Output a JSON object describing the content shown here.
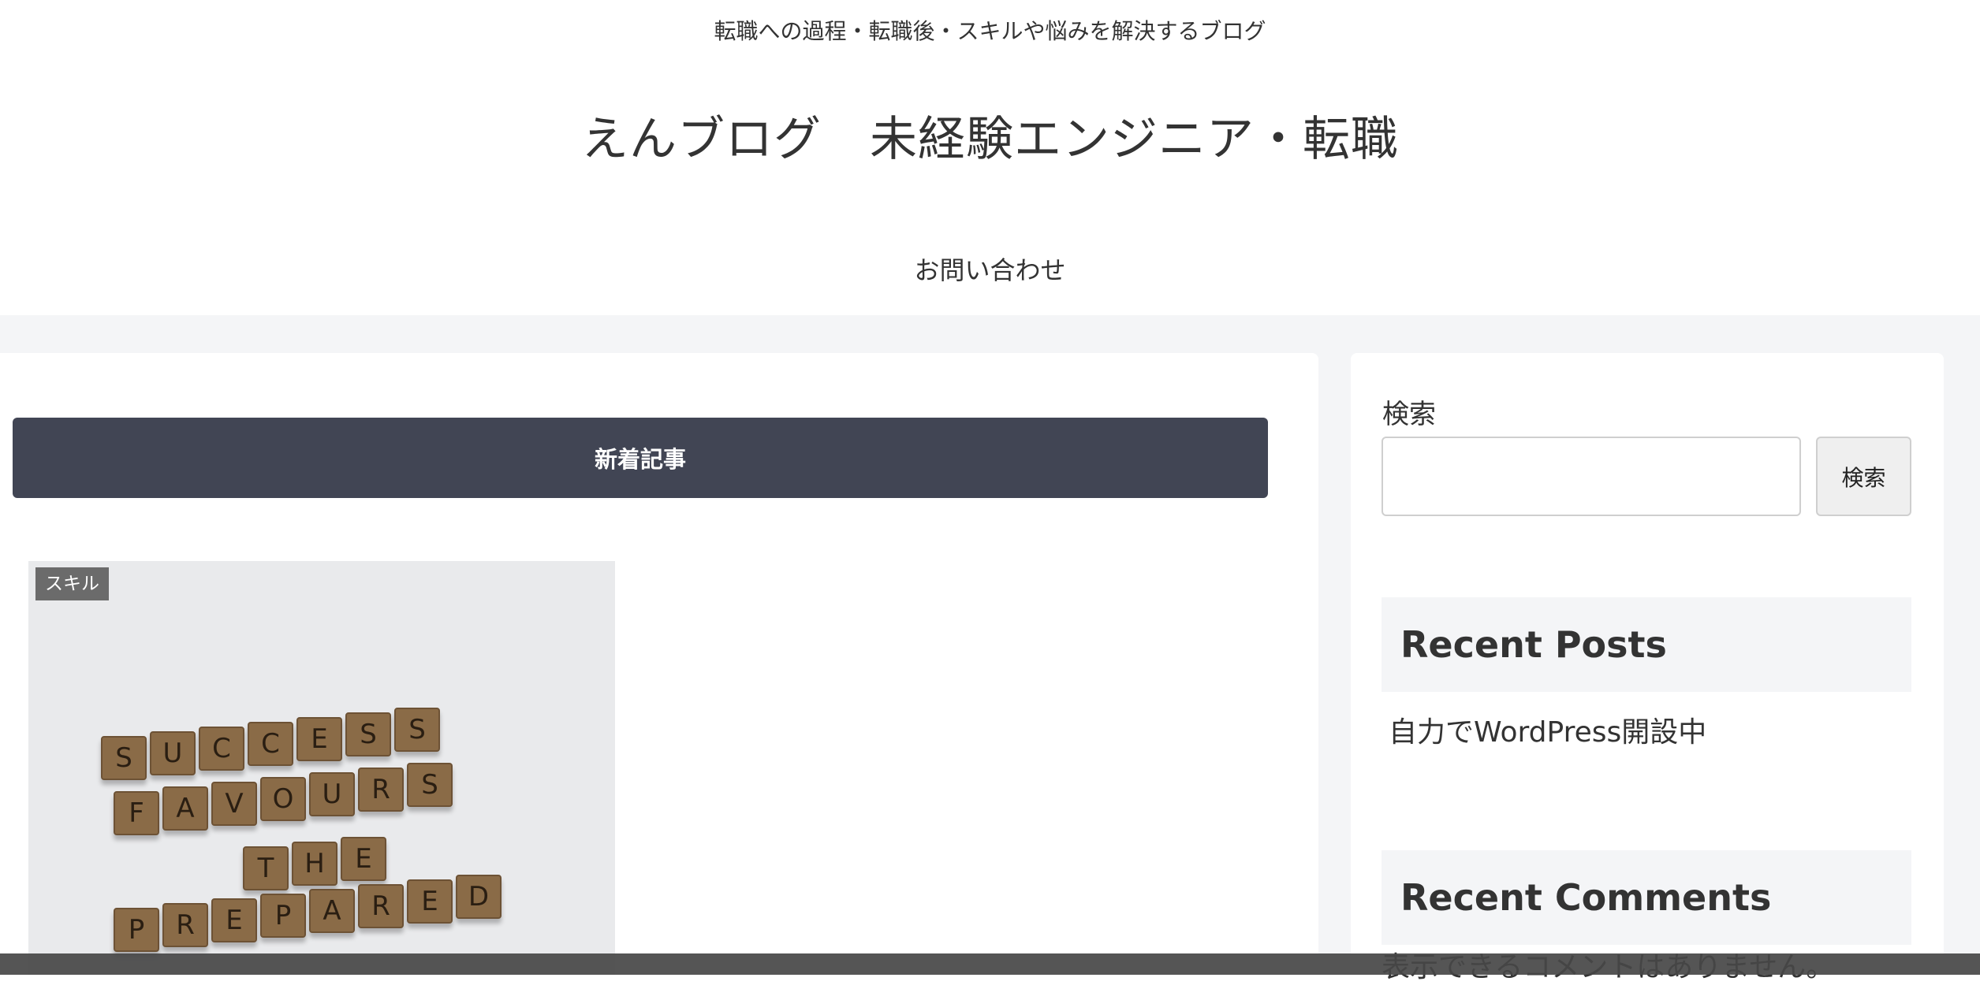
{
  "header": {
    "tagline": "転職への過程・転職後・スキルや悩みを解決するブログ",
    "site_title": "えんブログ　未経験エンジニア・転職",
    "nav": [
      {
        "label": "お問い合わせ"
      }
    ]
  },
  "main": {
    "section_heading": "新着記事",
    "posts": [
      {
        "category": "スキル",
        "thumbnail_tiles": [
          "SUCCESS",
          "FAVOURS",
          "THE",
          "PREPARED"
        ]
      }
    ]
  },
  "sidebar": {
    "search": {
      "label": "検索",
      "button_label": "検索",
      "value": "",
      "placeholder": ""
    },
    "recent_posts": {
      "title": "Recent Posts",
      "items": [
        {
          "label": "自力でWordPress開設中"
        }
      ]
    },
    "recent_comments": {
      "title": "Recent Comments",
      "empty_text": "表示できるコメントはありません。"
    }
  },
  "colors": {
    "page_background": "#f4f5f7",
    "heading_bar": "#414554",
    "category_label": "#6b6b6b",
    "widget_title_bg": "#f4f5f7",
    "text": "#333333"
  }
}
